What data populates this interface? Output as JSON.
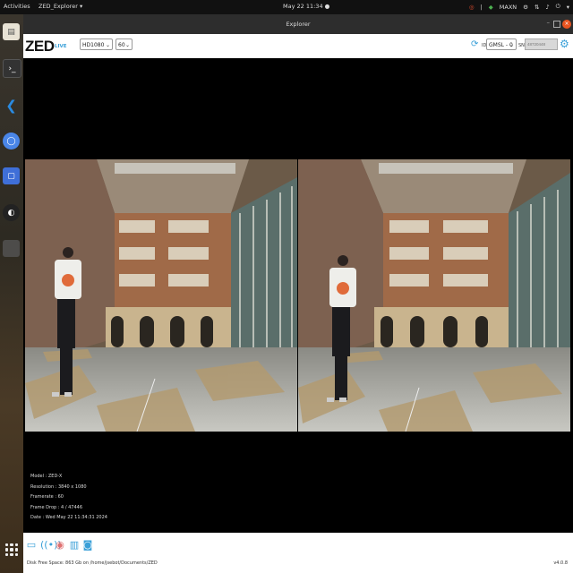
{
  "topbar": {
    "activities": "Activities",
    "app_menu": "ZED_Explorer ▾",
    "clock": "May 22  11:34  ●",
    "tray_maxn": "MAXN"
  },
  "window": {
    "title": "Explorer"
  },
  "toolbar": {
    "logo": "ZED",
    "live_label": "LIVE",
    "resolution_value": "HD1080",
    "fps_value": "60",
    "id_label": "ID",
    "camera_value": "GMSL - 0",
    "sn_label": "SN",
    "sn_placeholder": "48720448"
  },
  "camera_info": {
    "model": "Model : ZED-X",
    "resolution": "Resolution : 3840 x 1080",
    "framerate": "Framerate : 60",
    "frame_drop": "Frame Drop : 4 / 47446",
    "date": "Date : Wed May 22 11:34:31 2024"
  },
  "status_bar": {
    "disk_space": "Disk Free Space: 863 Gb  on  /home/jsebot/Documents/ZED",
    "version": "v4.0.8"
  },
  "colors": {
    "accent": "#3aa0d8",
    "ubuntu_orange": "#e95420"
  }
}
